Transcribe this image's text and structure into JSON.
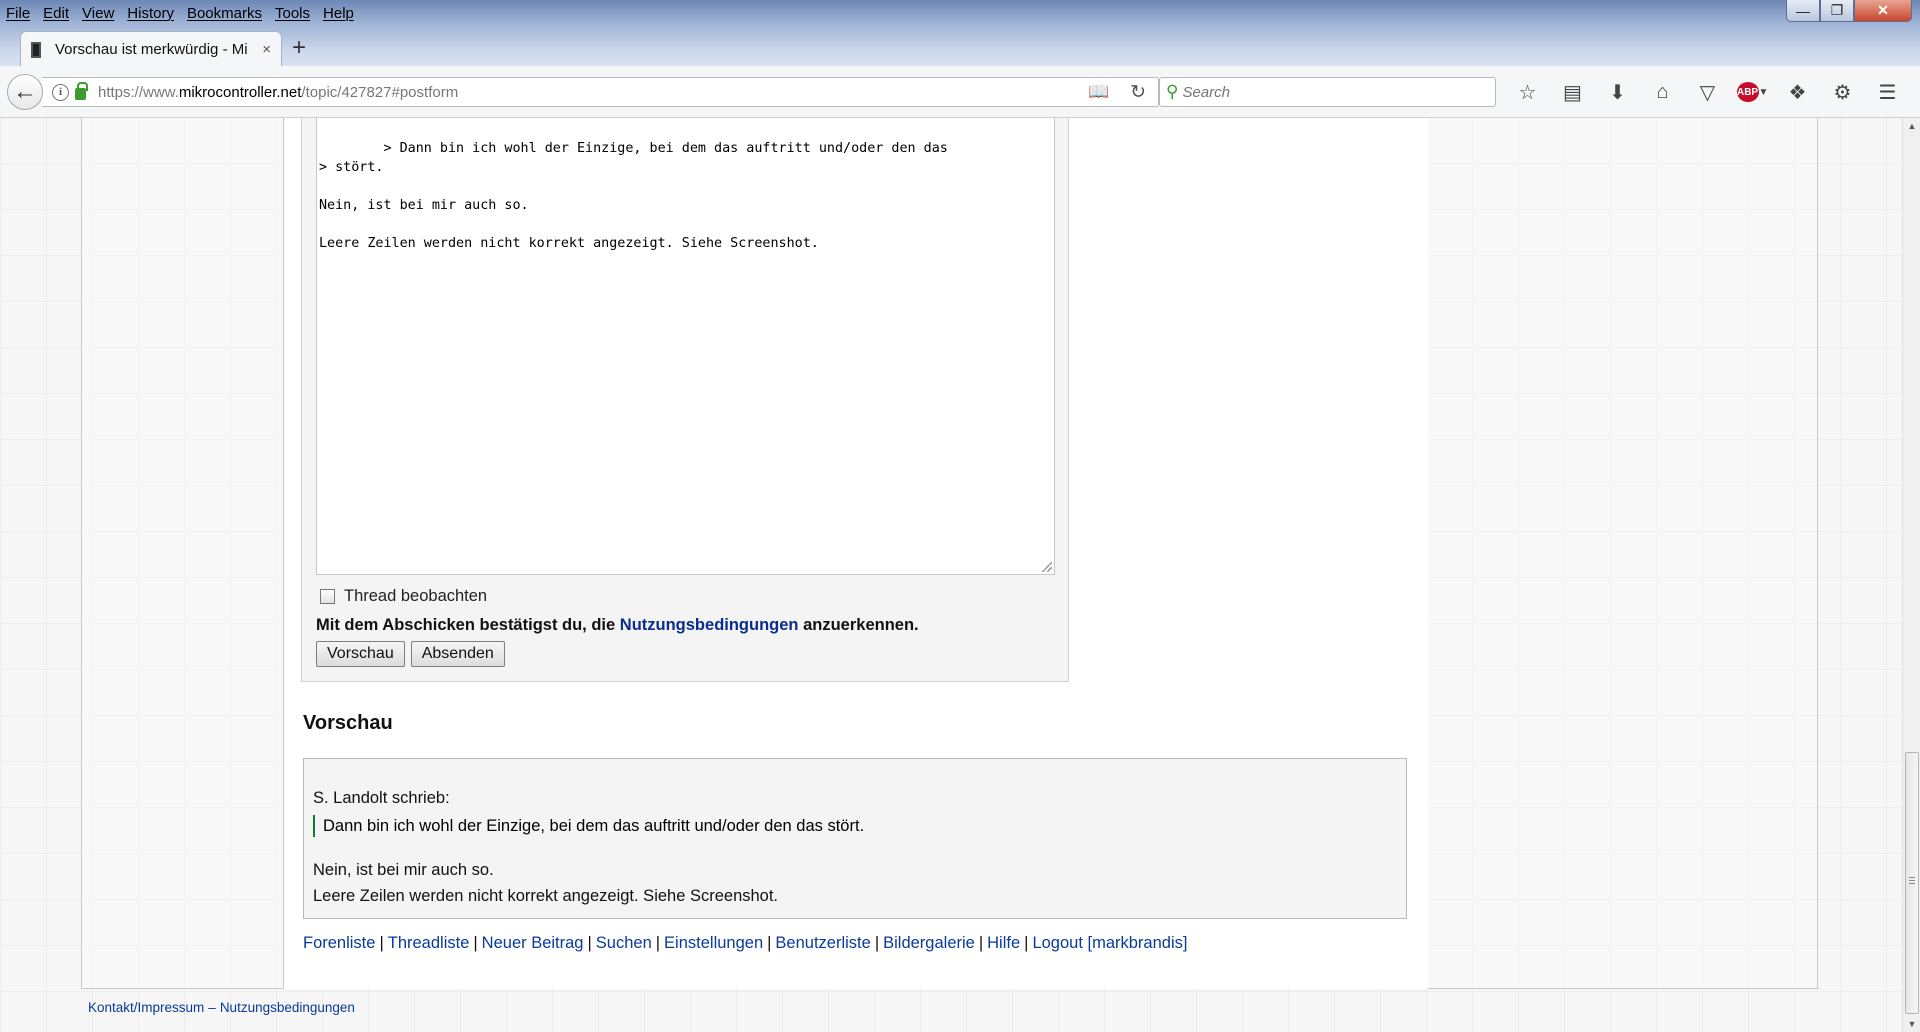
{
  "menu": [
    "File",
    "Edit",
    "View",
    "History",
    "Bookmarks",
    "Tools",
    "Help"
  ],
  "window_controls": {
    "minimize": "—",
    "restore": "❐",
    "close": "✕"
  },
  "tab": {
    "title": "Vorschau ist merkwürdig - Mi",
    "close": "×",
    "new": "+"
  },
  "address": {
    "prefix": "https://www.",
    "domain": "mikrocontroller.net",
    "path": "/topic/427827#postform"
  },
  "search": {
    "placeholder": "Search"
  },
  "toolbar_icons": [
    "star-icon",
    "reading-list-icon",
    "download-icon",
    "home-icon",
    "pocket-icon",
    "adblock-icon",
    "extension-icon",
    "addon-icon",
    "menu-icon"
  ],
  "editor": {
    "text": "> Dann bin ich wohl der Einzige, bei dem das auftritt und/oder den das\n> stört.\n\nNein, ist bei mir auch so.\n\nLeere Zeilen werden nicht korrekt angezeigt. Siehe Screenshot."
  },
  "watch_label": "Thread beobachten",
  "terms": {
    "before": "Mit dem Abschicken bestätigst du, die ",
    "link": "Nutzungsbedingungen",
    "after": " anzuerkennen."
  },
  "buttons": {
    "preview": "Vorschau",
    "submit": "Absenden"
  },
  "preview": {
    "heading": "Vorschau",
    "author": "S. Landolt schrieb:",
    "quote": "Dann bin ich wohl der Einzige, bei dem das auftritt und/oder den das stört.",
    "line1": "Nein, ist bei mir auch so.",
    "line2": "Leere Zeilen werden nicht korrekt angezeigt. Siehe Screenshot."
  },
  "footer_nav": [
    "Forenliste",
    "Threadliste",
    "Neuer Beitrag",
    "Suchen",
    "Einstellungen",
    "Benutzerliste",
    "Bildergalerie",
    "Hilfe",
    "Logout [markbrandis]"
  ],
  "bottom_links": {
    "contact": "Kontakt/Impressum",
    "dash": "–",
    "terms": "Nutzungsbedingungen"
  }
}
